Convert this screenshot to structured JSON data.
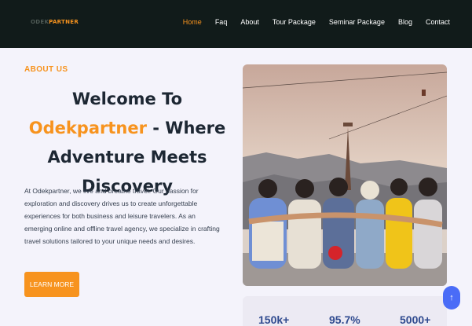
{
  "logo": {
    "part1": "ODEK",
    "part2": "PARTNER"
  },
  "nav": {
    "items": [
      "Home",
      "Faq",
      "About",
      "Tour Package",
      "Seminar Package",
      "Blog",
      "Contact"
    ],
    "active": "Home"
  },
  "about": {
    "label": "ABOUT US",
    "heading_pre": "Welcome To ",
    "heading_brand": "Odekpartner",
    "heading_post": " - Where Adventure Meets Discovery",
    "paragraph": "At Odekpartner, we live and breathe travel. Our passion for exploration and discovery drives us to create unforgettable experiences for both business and leisure travelers. As an emerging online and offline travel agency, we specialize in crafting travel solutions tailored to your unique needs and desires.",
    "button": "LEARN MORE"
  },
  "stats": [
    "150k+",
    "95.7%",
    "5000+"
  ],
  "scroll_top_icon": "↑",
  "colors": {
    "accent": "#f7931e",
    "nav_bg": "#111b1a",
    "stat": "#2f4a8f",
    "scroll_btn": "#4a6cf7"
  },
  "icons": {
    "scroll_top": "arrow-up-icon"
  }
}
